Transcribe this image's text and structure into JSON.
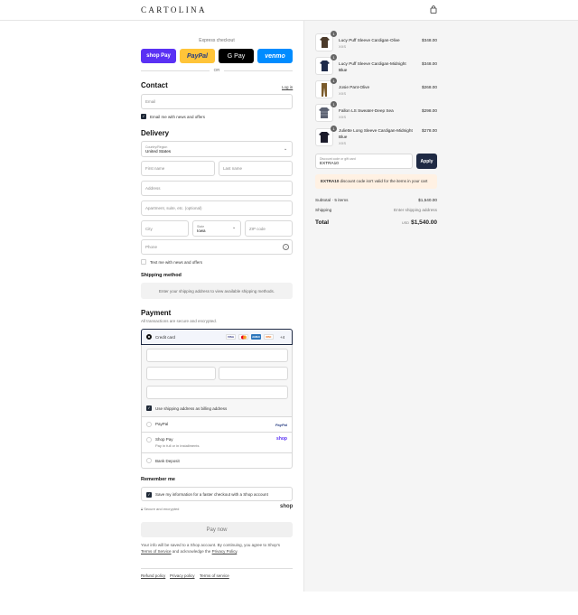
{
  "header": {
    "brand": "CARTOLINA",
    "cart_icon": "bag-icon"
  },
  "express": {
    "title": "Express checkout",
    "buttons": [
      {
        "label": "shop Pay",
        "color": "#5a31f4"
      },
      {
        "label": "PayPal",
        "color": "#ffc439"
      },
      {
        "label": "G Pay",
        "color": "#000000"
      },
      {
        "label": "venmo",
        "color": "#008cff"
      }
    ],
    "or": "OR"
  },
  "contact": {
    "title": "Contact",
    "login": "Log in",
    "email_placeholder": "Email",
    "news_label": "Email me with news and offers"
  },
  "delivery": {
    "title": "Delivery",
    "country_label": "Country/Region",
    "country_value": "United States",
    "first_name": "First name",
    "last_name": "Last name",
    "address": "Address",
    "apartment": "Apartment, suite, etc. (optional)",
    "city": "City",
    "state_label": "State",
    "state_value": "Iowa",
    "zip": "ZIP code",
    "phone": "Phone",
    "text_label": "Text me with news and offers"
  },
  "shipping": {
    "title": "Shipping method",
    "message": "Enter your shipping address to view available shipping methods."
  },
  "payment": {
    "title": "Payment",
    "subtitle": "All transactions are secure and encrypted.",
    "credit_card": "Credit card",
    "cards": [
      "VISA",
      "MC",
      "AMEX",
      "DISC"
    ],
    "more_cards": "+4",
    "billing_label": "Use shipping address as billing address",
    "paypal": "PayPal",
    "paypal_logo": "PayPal",
    "shop_pay": "Shop Pay",
    "shop_pay_sub": "Pay in full or in installments",
    "shop_logo": "shop",
    "bank": "Bank Deposit"
  },
  "remember": {
    "title": "Remember me",
    "save_label": "Save my information for a faster checkout with a Shop account",
    "secure": "Secure and encrypted",
    "shop_logo": "shop"
  },
  "pay_button": "Pay now",
  "disclaimer": {
    "text1": "Your info will be saved to a Shop account. By continuing, you agree to Shop's",
    "terms": "Terms of Service",
    "and": "and acknowledge the",
    "privacy": "Privacy Policy",
    "dot": "."
  },
  "footer": {
    "links": [
      "Refund policy",
      "Privacy policy",
      "Terms of service"
    ]
  },
  "cart": {
    "items": [
      {
        "qty": "1",
        "name": "Lucy Puff Sleeve Cardigan-Olive",
        "size": "XXS",
        "price": "$348.00",
        "color": "#4b3a2a"
      },
      {
        "qty": "1",
        "name": "Lucy Puff Sleeve Cardigan-Midnight Blue",
        "size": "XXS",
        "price": "$348.00",
        "color": "#1e2a4a"
      },
      {
        "qty": "1",
        "name": "Josie Pant-Olive",
        "size": "XXS",
        "price": "$268.00",
        "color": "#7a5a2a"
      },
      {
        "qty": "1",
        "name": "Fallon LS Sweater-Deep Sea",
        "size": "XXS",
        "price": "$298.00",
        "color": "#5a6070"
      },
      {
        "qty": "1",
        "name": "Juliette Long Sleeve Cardigan-Midnight Blue",
        "size": "XXS",
        "price": "$278.00",
        "color": "#1a1a2a"
      }
    ],
    "discount_label": "Discount code or gift card",
    "discount_value": "EXTRA10",
    "apply": "Apply",
    "error_code": "EXTRA10",
    "error_text": "discount code isn't valid for the items in your cart",
    "subtotal_label": "Subtotal · 5 items",
    "subtotal_value": "$1,540.00",
    "shipping_label": "Shipping",
    "shipping_value": "Enter shipping address",
    "total_label": "Total",
    "total_currency": "USD",
    "total_value": "$1,540.00"
  }
}
